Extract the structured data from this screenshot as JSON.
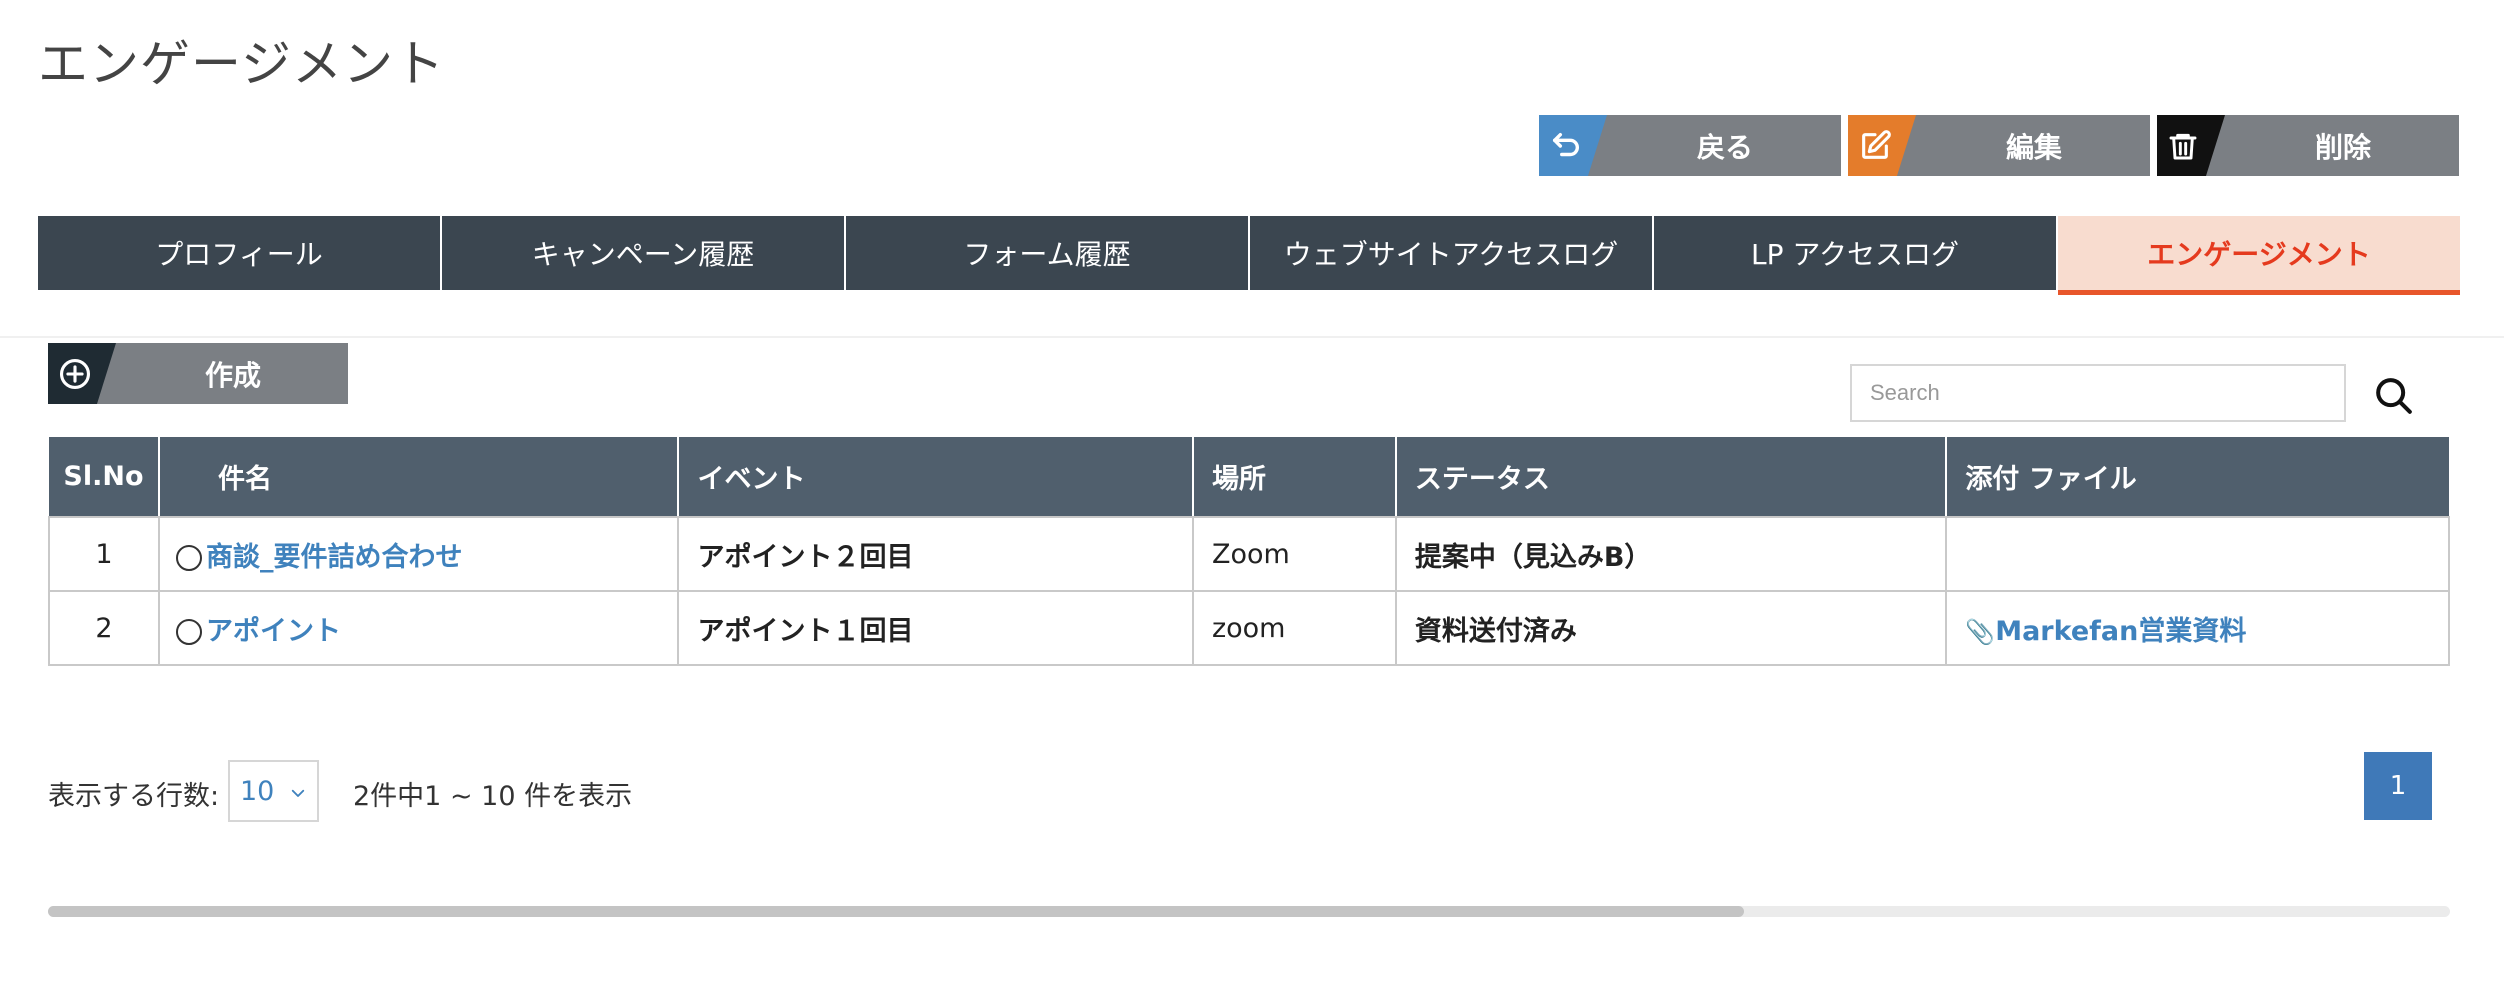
{
  "page": {
    "title": "エンゲージメント"
  },
  "actions": {
    "back_label": "戻る",
    "edit_label": "編集",
    "delete_label": "削除"
  },
  "tabs": [
    {
      "label": "プロフィール",
      "active": false
    },
    {
      "label": "キャンペーン履歴",
      "active": false
    },
    {
      "label": "フォーム履歴",
      "active": false
    },
    {
      "label": "ウェブサイトアクセスログ",
      "active": false
    },
    {
      "label": "LP アクセスログ",
      "active": false
    },
    {
      "label": "エンゲージメント",
      "active": true
    }
  ],
  "create": {
    "label": "作成"
  },
  "search": {
    "placeholder": "Search",
    "value": ""
  },
  "table": {
    "headers": {
      "no": "Sl.No",
      "subject": "件名",
      "event": "イベント",
      "place": "場所",
      "status": "ステータス",
      "attachment": "添付 ファイル"
    },
    "rows": [
      {
        "no": "1",
        "subject": "商談_要件詰め合わせ",
        "event": "アポイント２回目",
        "place": "Zoom",
        "status": "提案中（見込みB）",
        "attachment": ""
      },
      {
        "no": "2",
        "subject": "アポイント",
        "event": "アポイント１回目",
        "place": "zoom",
        "status": "資料送付済み",
        "attachment": "Markefan営業資料"
      }
    ]
  },
  "footer": {
    "rows_label": "表示する行数:",
    "rows_value": "10",
    "count_text": "2件中1 ~ 10 件を表示",
    "current_page": "1"
  },
  "colors": {
    "tab_bg": "#3b4650",
    "tab_active_bg": "#f8dccf",
    "tab_active_text": "#e53a1e",
    "header_bg": "#505f6d",
    "link": "#3f82bd",
    "back_icon": "#4a8cc7",
    "edit_icon": "#e47c2b",
    "delete_icon": "#111111"
  },
  "icons": {
    "back": "undo-arrow-icon",
    "edit": "edit-pencil-icon",
    "delete": "trash-icon",
    "create": "plus-circle-icon",
    "search": "search-icon",
    "attach": "paperclip-icon"
  }
}
